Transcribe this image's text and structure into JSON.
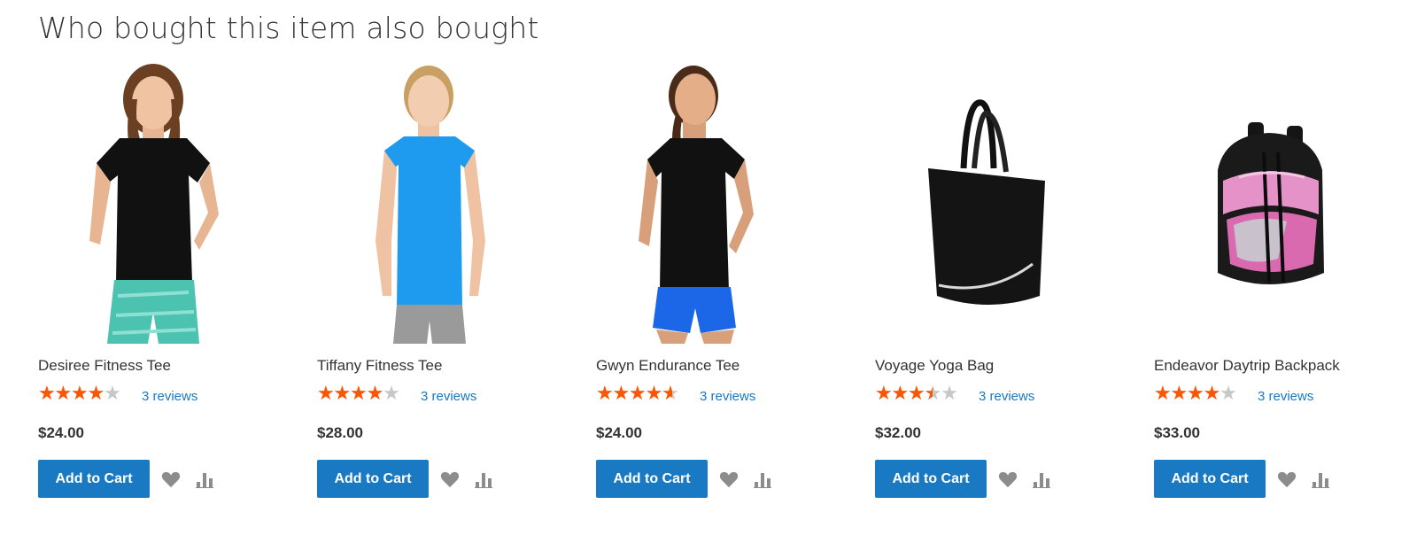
{
  "section": {
    "title": "Who bought this item also bought"
  },
  "colors": {
    "accent": "#1979c3",
    "star_filled": "#ff5501",
    "star_empty": "#c7c7c7",
    "action_icon": "#8c8c8c"
  },
  "products": [
    {
      "name": "Desiree Fitness Tee",
      "rating_fraction": 0.7,
      "stars_glyph": "★★★★★",
      "reviews": "3 reviews",
      "price": "$24.00",
      "add_to_cart": "Add to Cart",
      "image": "woman-black-tee-teal-pants"
    },
    {
      "name": "Tiffany Fitness Tee",
      "rating_fraction": 0.7,
      "stars_glyph": "★★★★★",
      "reviews": "3 reviews",
      "price": "$28.00",
      "add_to_cart": "Add to Cart",
      "image": "woman-blue-tee-gray-pants"
    },
    {
      "name": "Gwyn Endurance Tee",
      "rating_fraction": 0.8,
      "stars_glyph": "★★★★★",
      "reviews": "3 reviews",
      "price": "$24.00",
      "add_to_cart": "Add to Cart",
      "image": "woman-black-tee-blue-shorts"
    },
    {
      "name": "Voyage Yoga Bag",
      "rating_fraction": 0.6,
      "stars_glyph": "★★★★★",
      "reviews": "3 reviews",
      "price": "$32.00",
      "add_to_cart": "Add to Cart",
      "image": "black-tote-bag"
    },
    {
      "name": "Endeavor Daytrip Backpack",
      "rating_fraction": 0.7,
      "stars_glyph": "★★★★★",
      "reviews": "3 reviews",
      "price": "$33.00",
      "add_to_cart": "Add to Cart",
      "image": "pink-black-backpack"
    }
  ]
}
